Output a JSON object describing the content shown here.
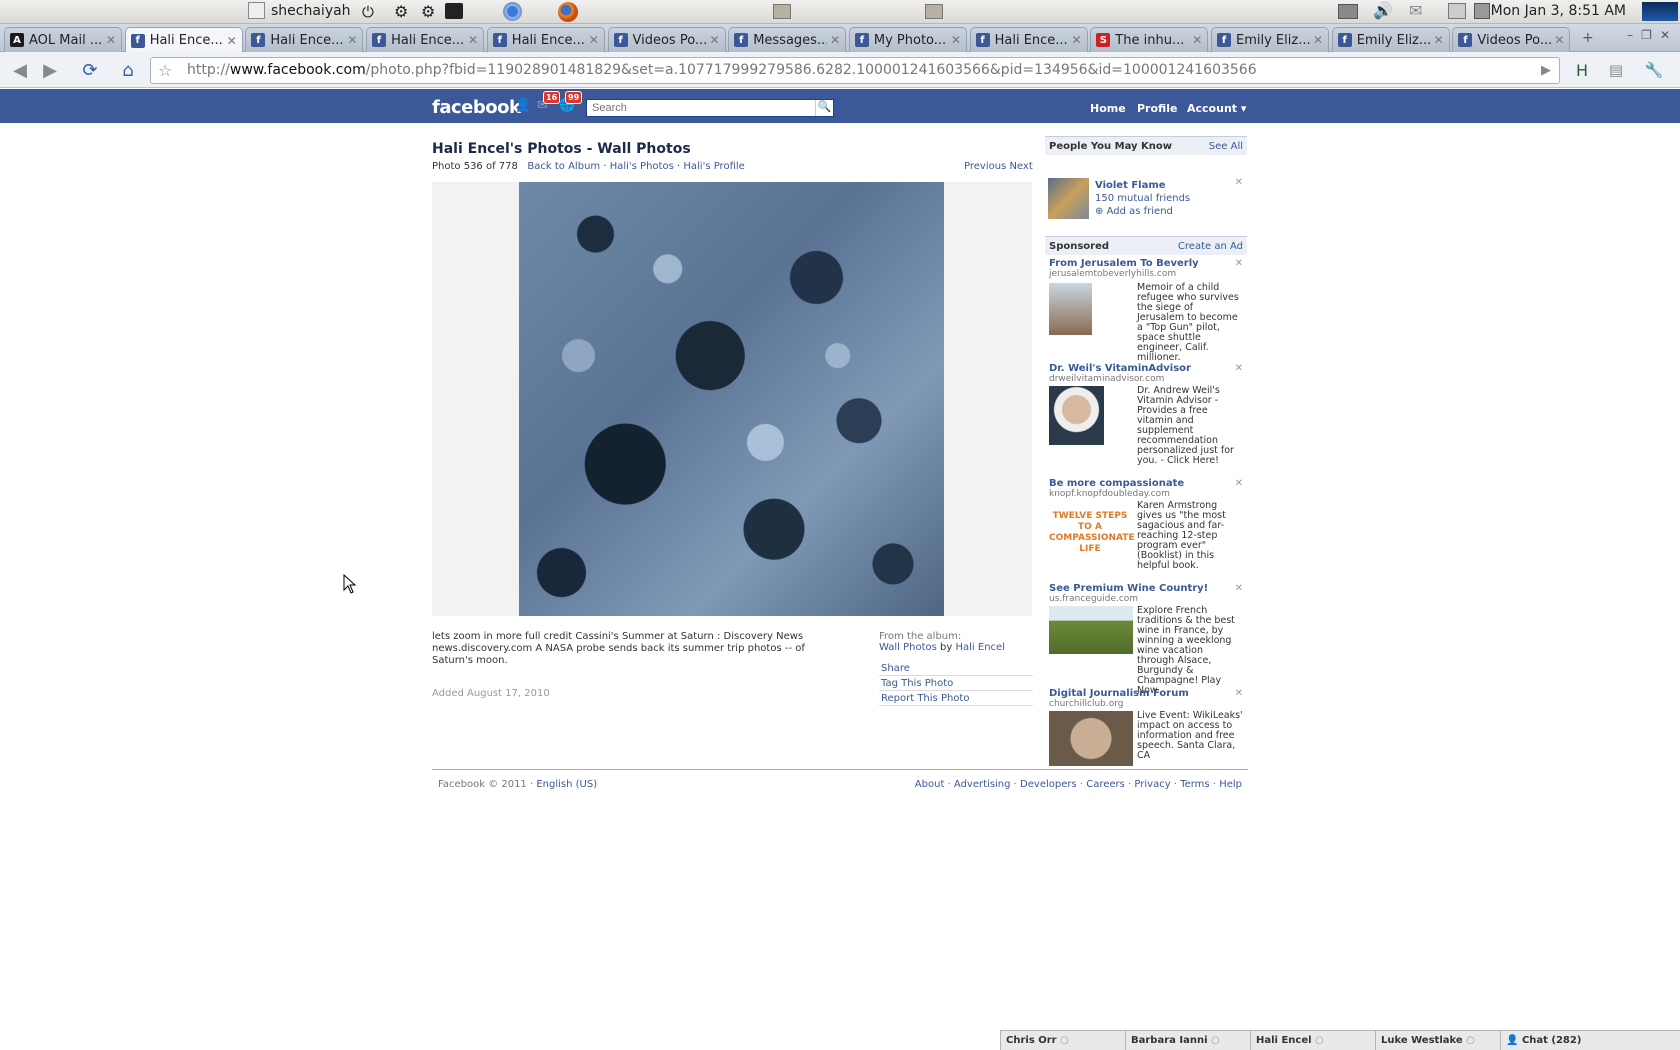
{
  "os_panel": {
    "user": "shechaiyah",
    "clock": "Mon Jan  3,  8:51 AM"
  },
  "tabs": [
    {
      "label": "AOL Mail ...",
      "favicon": "aol",
      "color": "#1a1a1a"
    },
    {
      "label": "Hali Ence...",
      "favicon": "facebook",
      "color": "#3b5998"
    },
    {
      "label": "Hali Ence...",
      "favicon": "facebook",
      "color": "#3b5998"
    },
    {
      "label": "Hali Ence...",
      "favicon": "facebook",
      "color": "#3b5998"
    },
    {
      "label": "Hali Ence...",
      "favicon": "facebook",
      "color": "#3b5998"
    },
    {
      "label": "Videos Po...",
      "favicon": "facebook",
      "color": "#3b5998"
    },
    {
      "label": "Messages...",
      "favicon": "facebook",
      "color": "#3b5998"
    },
    {
      "label": "My Photo...",
      "favicon": "facebook",
      "color": "#3b5998"
    },
    {
      "label": "Hali Ence...",
      "favicon": "facebook",
      "color": "#3b5998"
    },
    {
      "label": "The inhu...",
      "favicon": "red-s",
      "color": "#cc2222"
    },
    {
      "label": "Emily Eliz...",
      "favicon": "facebook",
      "color": "#3b5998"
    },
    {
      "label": "Emily Eliz...",
      "favicon": "facebook",
      "color": "#3b5998"
    },
    {
      "label": "Videos Po...",
      "favicon": "facebook",
      "color": "#3b5998"
    }
  ],
  "active_tab": 1,
  "address_bar": {
    "scheme": "http://",
    "host": "www.facebook.com",
    "path": "/photo.php?fbid=119028901481829&set=a.107717999279586.6282.100001241603566&pid=134956&id=100001241603566"
  },
  "fb_header": {
    "logo": "facebook",
    "badge_messages": "16",
    "badge_notifications": "99",
    "search_placeholder": "Search",
    "nav_home": "Home",
    "nav_profile": "Profile",
    "nav_account": "Account ▾"
  },
  "photo": {
    "title": "Hali Encel's Photos - Wall Photos",
    "counter": "Photo 536 of 778",
    "back_to_album": "Back to Album",
    "halis_photos": "Hali's Photos",
    "halis_profile": "Hali's Profile",
    "sep": "·",
    "previous": "Previous",
    "next": "Next",
    "caption": "lets zoom in more full credit Cassini's Summer at Saturn : Discovery News news.discovery.com A NASA probe sends back its summer trip photos -- of Saturn's moon.",
    "added": "Added August 17, 2010",
    "from_album_label": "From the album:",
    "album_name": "Wall Photos",
    "by": "by",
    "album_owner": "Hali Encel",
    "share": "Share",
    "tag": "Tag This Photo",
    "report": "Report This Photo"
  },
  "right_column": {
    "pymk_title": "People You May Know",
    "see_all": "See All",
    "pymk_name": "Violet Flame",
    "pymk_mutual": "150 mutual friends",
    "pymk_add": "Add as friend",
    "sponsored_title": "Sponsored",
    "create_ad": "Create an Ad",
    "ads": [
      {
        "title": "From Jerusalem To Beverly",
        "url": "jerusalemtobeverlyhills.com",
        "body": "Memoir of a child refugee who survives the siege of Jerusalem to become a \"Top Gun\" pilot, space shuttle engineer, Calif. millioner."
      },
      {
        "title": "Dr. Weil's VitaminAdvisor",
        "url": "drweilvitaminadvisor.com",
        "body": "Dr. Andrew Weil's Vitamin Advisor - Provides a free vitamin and supplement recommendation personalized just for you. - Click Here!"
      },
      {
        "title": "Be more compassionate",
        "url": "knopf.knopfdoubleday.com",
        "body": "Karen Armstrong gives us \"the most sagacious and far-reaching 12-step program ever\" (Booklist) in this helpful book.",
        "image_text": "TWELVE STEPS TO A COMPASSIONATE LIFE"
      },
      {
        "title": "See Premium Wine Country!",
        "url": "us.franceguide.com",
        "body": "Explore French traditions & the best wine in France, by winning a weeklong wine vacation through Alsace, Burgundy & Champagne! Play Now"
      },
      {
        "title": "Digital Journalism Forum",
        "url": "churchillclub.org",
        "body": "Live Event: WikiLeaks' impact on access to information and free speech. Santa Clara, CA"
      }
    ]
  },
  "footer": {
    "copyright": "Facebook © 2011 ·",
    "language": "English (US)",
    "links": [
      "About",
      "Advertising",
      "Developers",
      "Careers",
      "Privacy",
      "Terms",
      "Help"
    ]
  },
  "chat": {
    "friends": [
      "Chris Orr",
      "Barbara Ianni",
      "Hali Encel",
      "Luke Westlake"
    ],
    "chat_label": "Chat (282)"
  }
}
